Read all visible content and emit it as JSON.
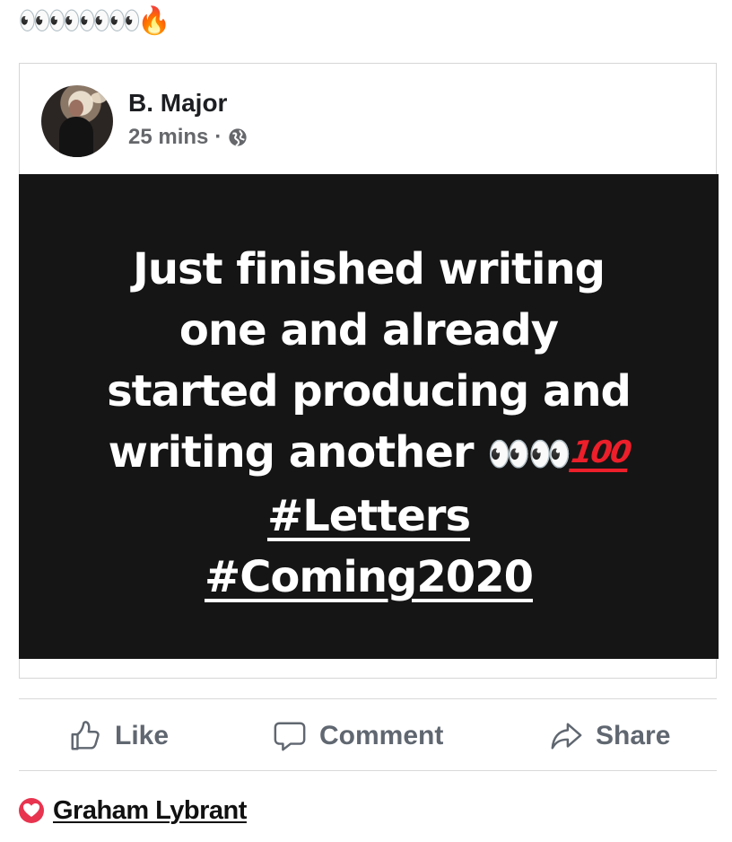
{
  "caption": {
    "emoji": "👀👀👀👀🔥"
  },
  "post": {
    "author": "B. Major",
    "time": "25 mins",
    "separator": "·",
    "privacy_icon": "globe-icon",
    "text_lines": [
      "Just finished writing",
      "one and already",
      "started producing and",
      "writing another"
    ],
    "trailing_emoji": "👀👀",
    "hundred_label": "100",
    "hashtags": [
      "#Letters",
      "#Coming2020"
    ],
    "background_color": "#151515",
    "text_color": "#ffffff"
  },
  "actions": [
    {
      "label": "Like",
      "icon": "thumbs-up-icon"
    },
    {
      "label": "Comment",
      "icon": "comment-bubble-icon"
    },
    {
      "label": "Share",
      "icon": "share-arrow-icon"
    }
  ],
  "reaction": {
    "icon": "heart-icon",
    "name": "Graham Lybrant",
    "color": "#e8344f"
  }
}
